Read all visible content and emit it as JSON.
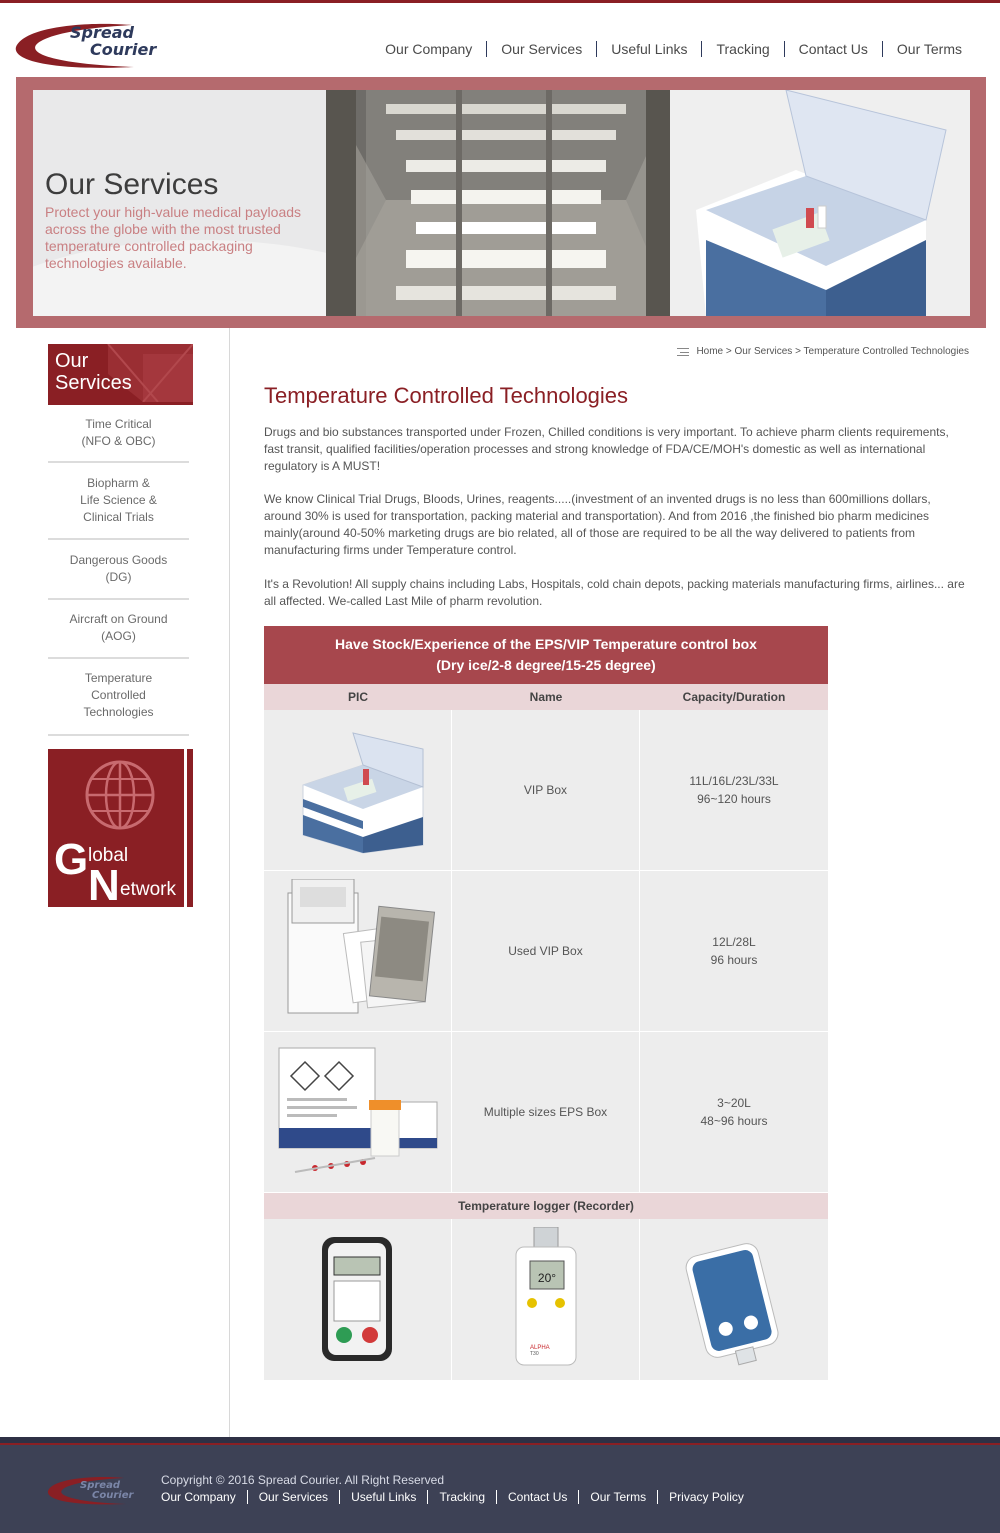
{
  "logo": {
    "line1": "Spread",
    "line2": "Courier"
  },
  "nav": [
    "Our Company",
    "Our Services",
    "Useful Links",
    "Tracking",
    "Contact Us",
    "Our Terms"
  ],
  "banner": {
    "title": "Our Services",
    "subtitle": "Protect your high-value medical payloads across the globe with the most trusted temperature controlled packaging technologies available."
  },
  "sidebar": {
    "title_line1": "Our",
    "title_line2": "Services",
    "items": [
      "Time Critical\n(NFO & OBC)",
      "Biopharm &\nLife Science &\nClinical Trials",
      "Dangerous Goods\n(DG)",
      "Aircraft on Ground\n(AOG)",
      "Temperature\nControlled\nTechnologies"
    ],
    "global_big1": "G",
    "global_small1": "lobal",
    "global_big2": "N",
    "global_small2": "etwork"
  },
  "breadcrumb": "Home > Our Services > Temperature Controlled Technologies",
  "main": {
    "title": "Temperature Controlled Technologies",
    "paragraphs": [
      "Drugs and bio substances transported under Frozen, Chilled conditions is very important. To achieve pharm clients requirements, fast transit, qualified facilities/operation processes and strong knowledge of FDA/CE/MOH's domestic as well as international regulatory is A MUST!",
      "We know Clinical Trial Drugs, Bloods, Urines, reagents.....(investment of an invented drugs is no less than 600millions dollars, around 30% is used for transportation, packing material and transportation). And from 2016 ,the finished bio pharm medicines mainly(around 40-50% marketing drugs are bio related, all of those are required to be all the way delivered to patients from manufacturing firms under Temperature control.",
      "It's a Revolution! All supply chains including Labs, Hospitals, cold chain depots, packing materials manufacturing firms, airlines... are all affected. We-called Last Mile of pharm revolution."
    ]
  },
  "table": {
    "head_line1": "Have Stock/Experience of the EPS/VIP Temperature control box",
    "head_line2": "(Dry ice/2-8 degree/15-25 degree)",
    "columns": [
      "PIC",
      "Name",
      "Capacity/Duration"
    ],
    "rows": [
      {
        "name": "VIP Box",
        "capacity": "11L/16L/23L/33L\n96~120 hours"
      },
      {
        "name": "Used VIP Box",
        "capacity": "12L/28L\n96 hours"
      },
      {
        "name": "Multiple sizes EPS Box",
        "capacity": "3~20L\n48~96 hours"
      }
    ],
    "logger_title": "Temperature logger (Recorder)",
    "logger2_display": "20°",
    "logger2_brand": "ALPHA",
    "logger2_model": "T30"
  },
  "footer": {
    "copyright": "Copyright © 2016 Spread Courier. All Right Reserved",
    "links": [
      "Our Company",
      "Our Services",
      "Useful Links",
      "Tracking",
      "Contact Us",
      "Our Terms",
      "Privacy Policy"
    ]
  },
  "colors": {
    "brand": "#8a1f24",
    "banner_border": "#b56a6e",
    "footer": "#3d4155"
  }
}
